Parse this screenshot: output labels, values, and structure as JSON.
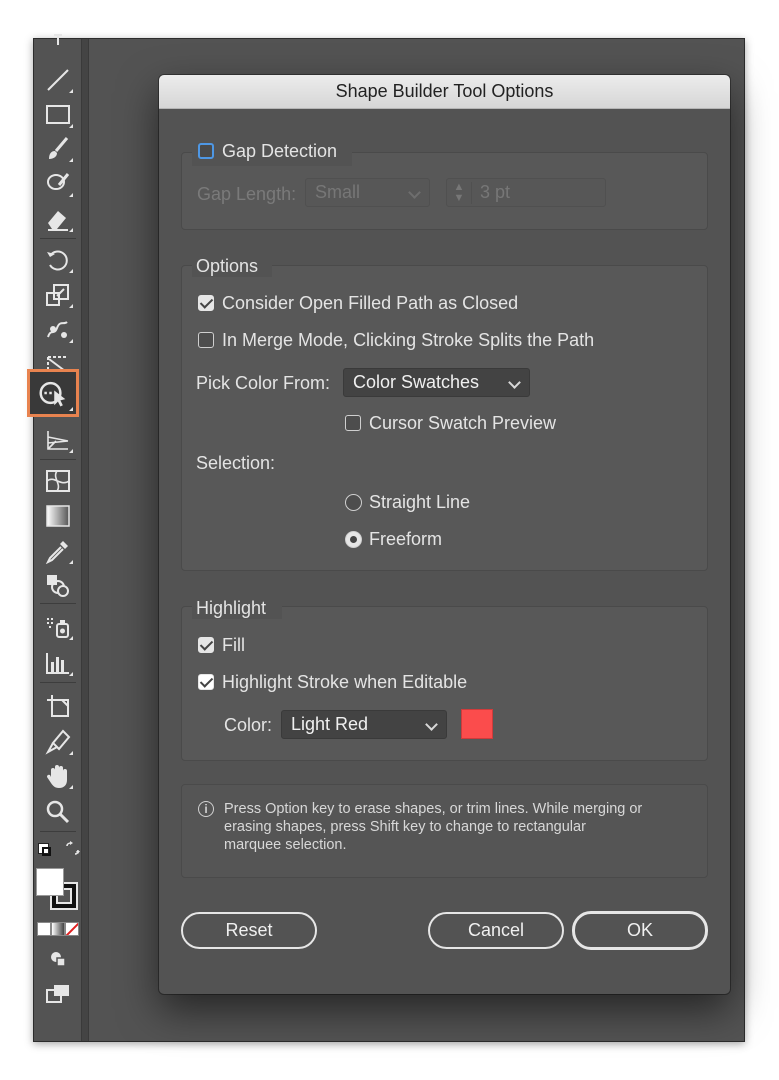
{
  "dialog": {
    "title": "Shape Builder Tool Options",
    "gap_detection": {
      "label": "Gap Detection",
      "checked": false,
      "gap_length_label": "Gap Length:",
      "gap_length_value": "Small",
      "gap_amount_value": "3 pt"
    },
    "options": {
      "header": "Options",
      "consider_open_filled": {
        "label": "Consider Open Filled Path as Closed",
        "checked": true
      },
      "merge_mode_split": {
        "label": "In Merge Mode, Clicking Stroke Splits the Path",
        "checked": false
      },
      "pick_color_from_label": "Pick Color From:",
      "pick_color_from_value": "Color Swatches",
      "cursor_swatch_preview": {
        "label": "Cursor Swatch Preview",
        "checked": false
      },
      "selection_label": "Selection:",
      "selection_straight_line": "Straight Line",
      "selection_freeform": "Freeform",
      "selection_value": "Freeform"
    },
    "highlight": {
      "header": "Highlight",
      "fill": {
        "label": "Fill",
        "checked": true
      },
      "highlight_stroke": {
        "label": "Highlight Stroke when Editable",
        "checked": true
      },
      "color_label": "Color:",
      "color_value": "Light Red",
      "swatch_color": "#fb4c4c"
    },
    "info": {
      "line1": "Press Option key to erase shapes, or trim lines. While merging or",
      "line2": "erasing shapes, press Shift key to change to rectangular",
      "line3": "marquee selection."
    },
    "buttons": {
      "reset": "Reset",
      "cancel": "Cancel",
      "ok": "OK"
    }
  },
  "toolbar": {
    "selected_tool": "shape-builder-tool",
    "accent_color": "#e8834f",
    "tools": [
      "type-tool",
      "line-segment-tool",
      "rectangle-tool",
      "paintbrush-tool",
      "shaper-tool",
      "eraser-tool",
      "rotate-tool",
      "scale-tool",
      "puppet-warp-tool",
      "free-transform-tool",
      "shape-builder-tool",
      "perspective-grid-tool",
      "mesh-tool",
      "gradient-tool",
      "eyedropper-tool",
      "blend-tool",
      "symbol-sprayer-tool",
      "column-graph-tool",
      "artboard-tool",
      "slice-tool",
      "hand-tool",
      "zoom-tool"
    ]
  }
}
